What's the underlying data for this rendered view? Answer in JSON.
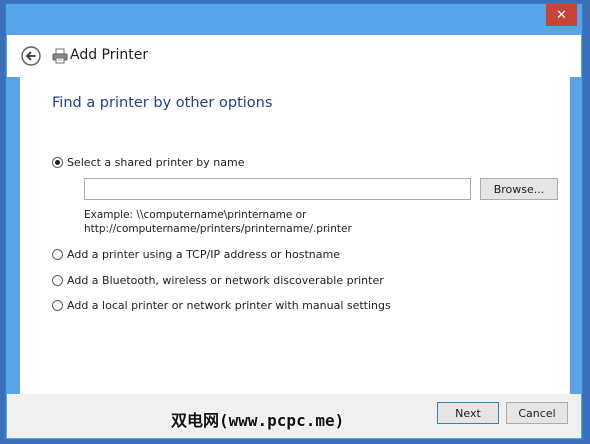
{
  "window": {
    "close_label": "✕"
  },
  "header": {
    "title": "Add Printer"
  },
  "page": {
    "title": "Find a printer by other options"
  },
  "options": [
    {
      "label": "Select a shared printer by name",
      "selected": true
    },
    {
      "label": "Add a printer using a TCP/IP address or hostname",
      "selected": false
    },
    {
      "label": "Add a Bluetooth, wireless or network discoverable printer",
      "selected": false
    },
    {
      "label": "Add a local printer or network printer with manual settings",
      "selected": false
    }
  ],
  "shared_printer": {
    "value": "",
    "browse_label": "Browse...",
    "example_line1": "Example: \\\\computername\\printername or",
    "example_line2": "http://computername/printers/printername/.printer"
  },
  "footer": {
    "next_label": "Next",
    "cancel_label": "Cancel"
  },
  "watermark": {
    "text": "双电网(www.pcpc.me)"
  },
  "colors": {
    "title_bar": "#59a3e9",
    "close_button": "#c7443a",
    "page_title": "#1f3f8f",
    "footer": "#f0f0f0"
  },
  "icons": {
    "back": "back-arrow-icon",
    "printer": "printer-icon",
    "close": "close-icon"
  }
}
